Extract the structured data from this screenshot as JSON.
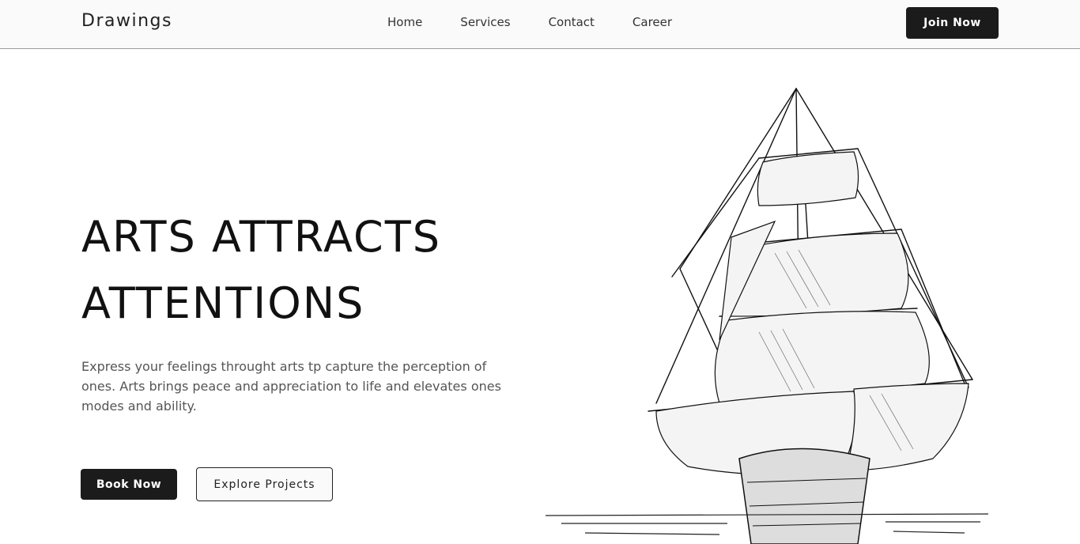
{
  "nav": {
    "brand": "Drawings",
    "links": [
      "Home",
      "Services",
      "Contact",
      "Career"
    ],
    "join_label": "Join Now"
  },
  "hero": {
    "title_line1": "ARTS ATTRACTS",
    "title_line2": "ATTENTIONS",
    "description": "Express your feelings throught arts tp capture the perception of ones. Arts brings peace and appreciation to life and elevates ones modes and ability.",
    "book_label": "Book Now",
    "explore_label": "Explore Projects"
  },
  "colors": {
    "dark_button": "#1b1b1b",
    "navbar_bg": "#fafafa"
  },
  "image": {
    "icon": "sailing-ship-sketch"
  }
}
